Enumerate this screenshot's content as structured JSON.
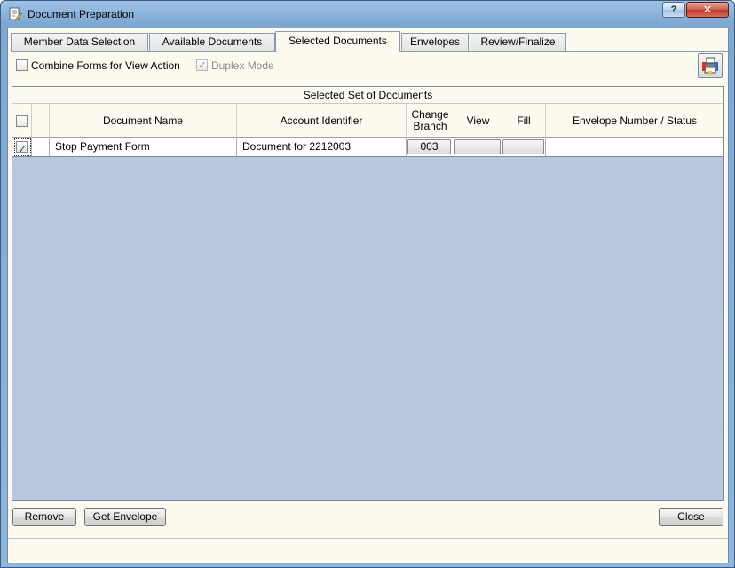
{
  "window": {
    "title": "Document Preparation",
    "help_label": "?",
    "close_label": "✕"
  },
  "tabs": [
    {
      "label": "Member Data Selection",
      "active": false
    },
    {
      "label": "Available Documents",
      "active": false
    },
    {
      "label": "Selected Documents",
      "active": true
    },
    {
      "label": "Envelopes",
      "active": false
    },
    {
      "label": "Review/Finalize",
      "active": false
    }
  ],
  "options": {
    "combine_forms": {
      "label": "Combine Forms for View Action",
      "checked": false
    },
    "duplex_mode": {
      "label": "Duplex Mode",
      "checked": true,
      "disabled": true
    }
  },
  "grid": {
    "caption": "Selected Set of Documents",
    "columns": {
      "document_name": "Document Name",
      "account_identifier": "Account Identifier",
      "change_branch": "Change Branch",
      "view": "View",
      "fill": "Fill",
      "envelope_status": "Envelope Number / Status"
    },
    "rows": [
      {
        "selected": true,
        "document_name": "Stop Payment Form",
        "account_identifier": "Document for 2212003",
        "branch": "003",
        "view": "",
        "fill": "",
        "envelope_status": ""
      }
    ]
  },
  "buttons": {
    "remove": "Remove",
    "get_envelope": "Get Envelope",
    "close": "Close"
  },
  "colors": {
    "titlebar": "#8fb6dc",
    "client_bg": "#fdfaf0",
    "grid_bg": "#b8c8de",
    "close_button": "#c0392b"
  }
}
